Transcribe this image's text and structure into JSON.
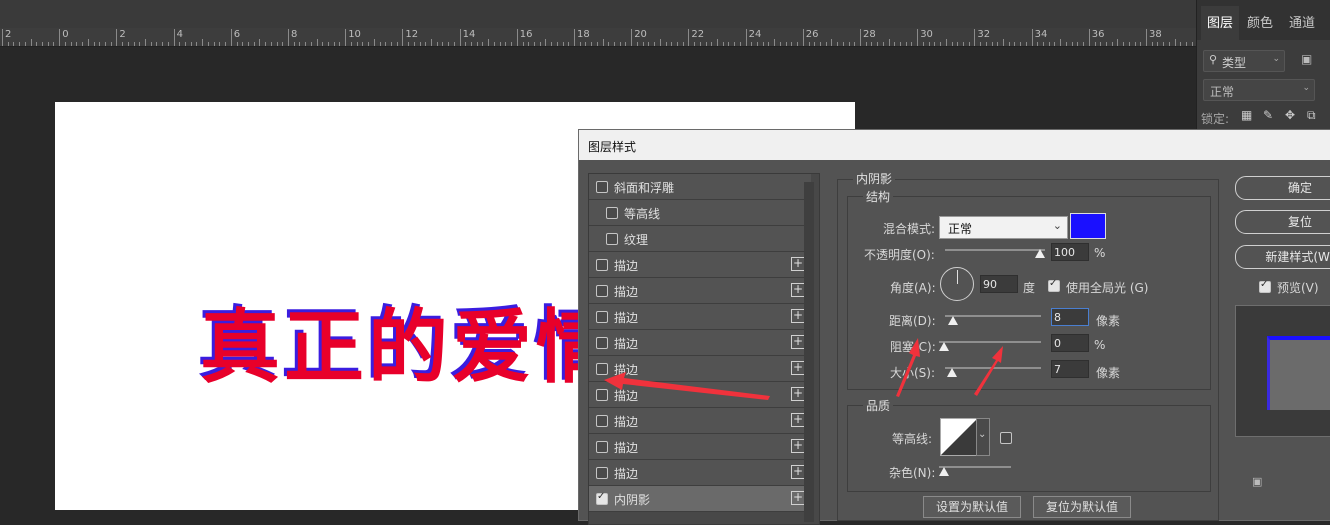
{
  "ruler": {
    "labels": [
      "2",
      "0",
      "2",
      "4",
      "6",
      "8",
      "10",
      "12",
      "14",
      "16",
      "18",
      "20",
      "22",
      "24",
      "26",
      "28",
      "30",
      "32",
      "34",
      "36",
      "38"
    ]
  },
  "canvas": {
    "text": "真正的爱情"
  },
  "layers_panel": {
    "tabs": [
      "图层",
      "颜色",
      "通道"
    ],
    "filter_placeholder": "类型",
    "blend_mode": "正常",
    "lock_label": "锁定:"
  },
  "dialog": {
    "title": "图层样式",
    "style_items": [
      {
        "label": "斜面和浮雕",
        "checked": false,
        "indent": false,
        "plus": false
      },
      {
        "label": "等高线",
        "checked": false,
        "indent": true,
        "plus": false
      },
      {
        "label": "纹理",
        "checked": false,
        "indent": true,
        "plus": false
      },
      {
        "label": "描边",
        "checked": false,
        "indent": false,
        "plus": true
      },
      {
        "label": "描边",
        "checked": false,
        "indent": false,
        "plus": true
      },
      {
        "label": "描边",
        "checked": false,
        "indent": false,
        "plus": true
      },
      {
        "label": "描边",
        "checked": false,
        "indent": false,
        "plus": true
      },
      {
        "label": "描边",
        "checked": false,
        "indent": false,
        "plus": true
      },
      {
        "label": "描边",
        "checked": false,
        "indent": false,
        "plus": true
      },
      {
        "label": "描边",
        "checked": false,
        "indent": false,
        "plus": true
      },
      {
        "label": "描边",
        "checked": false,
        "indent": false,
        "plus": true
      },
      {
        "label": "描边",
        "checked": false,
        "indent": false,
        "plus": true
      },
      {
        "label": "内阴影",
        "checked": true,
        "indent": false,
        "plus": true,
        "selected": true
      }
    ],
    "section_title": "内阴影",
    "structure": {
      "title": "结构",
      "blend_mode_label": "混合模式:",
      "blend_mode_value": "正常",
      "shadow_color": "#1a10ff",
      "opacity_label": "不透明度(O):",
      "opacity_value": "100",
      "opacity_unit": "%",
      "opacity_level": 1.0,
      "angle_label": "角度(A):",
      "angle_value": "90",
      "angle_unit": "度",
      "global_light_label": "使用全局光 (G)",
      "global_light_checked": true,
      "distance_label": "距离(D):",
      "distance_value": "8",
      "distance_unit": "像素",
      "choke_label": "阻塞(C):",
      "choke_value": "0",
      "choke_unit": "%",
      "size_label": "大小(S):",
      "size_value": "7",
      "size_unit": "像素"
    },
    "quality": {
      "title": "品质",
      "contour_label": "等高线:",
      "noise_label": "杂色(N):"
    },
    "buttons": {
      "ok": "确定",
      "reset": "复位",
      "new_style": "新建样式(W)",
      "preview": "预览(V)",
      "set_default": "设置为默认值",
      "reset_default": "复位为默认值"
    },
    "preview_checked": true
  },
  "colors": {
    "annotation_arrow": "#f0323c",
    "shadow": "#1a10ff",
    "text": "#e8002a"
  }
}
